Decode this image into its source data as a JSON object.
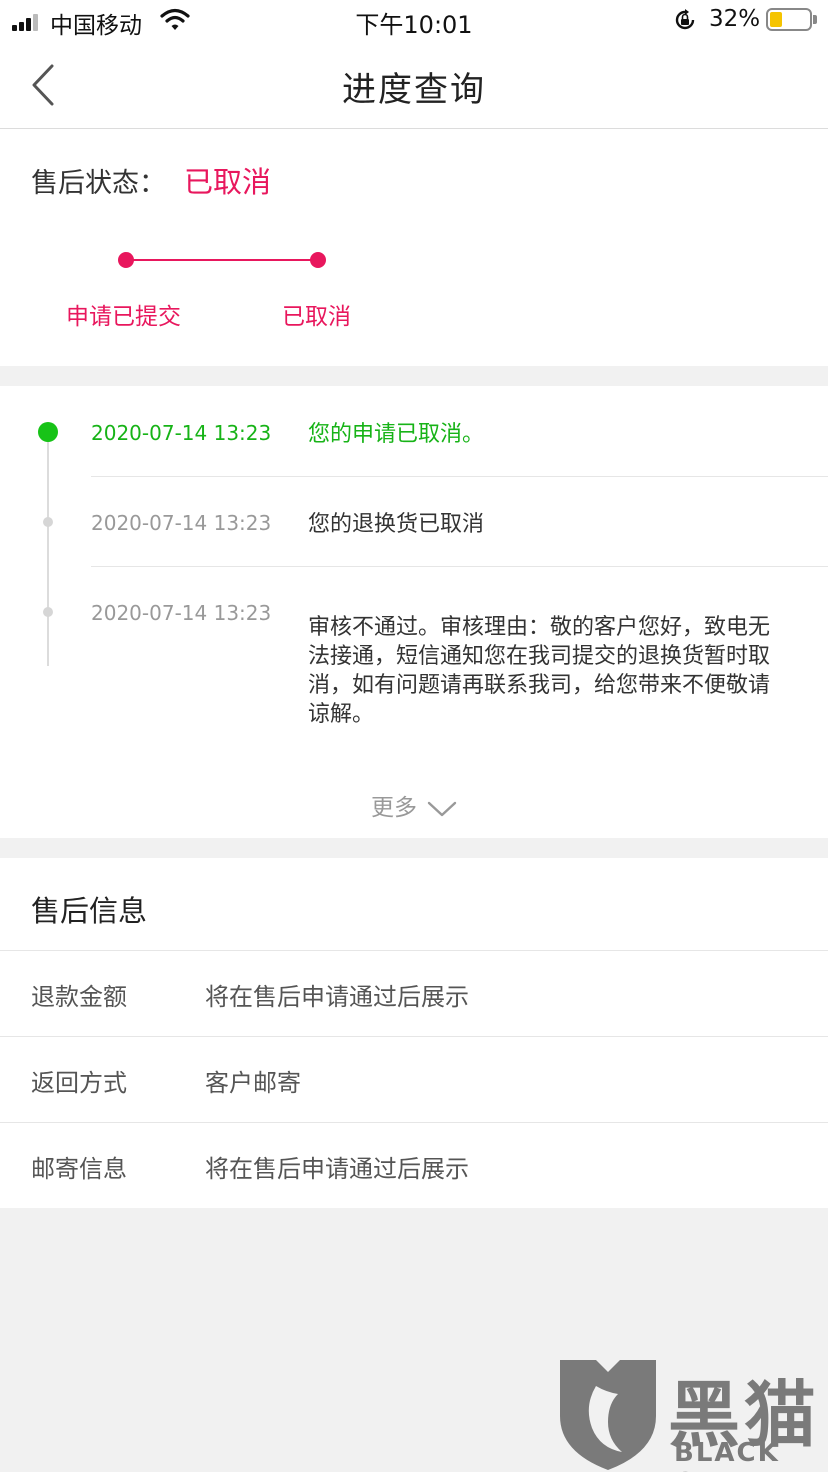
{
  "status_bar": {
    "carrier": "中国移动",
    "time": "下午10:01",
    "battery_percent": "32%",
    "battery_level": 0.32
  },
  "nav": {
    "title": "进度查询",
    "back_icon": "chevron-left-icon"
  },
  "status": {
    "label": "售后状态：",
    "value": "已取消",
    "steps": [
      "申请已提交",
      "已取消"
    ],
    "accent_color": "#e8175d"
  },
  "timeline": {
    "items": [
      {
        "time": "2020-07-14 13:23",
        "text": "您的申请已取消。"
      },
      {
        "time": "2020-07-14 13:23",
        "text": "您的退换货已取消"
      },
      {
        "time": "2020-07-14 13:23",
        "text": "审核不通过。审核理由：敬的客户您好，致电无法接通，短信通知您在我司提交的退换货暂时取消，如有问题请再联系我司，给您带来不便敬请谅解。"
      }
    ],
    "active_color": "#17b317",
    "more_label": "更多"
  },
  "info": {
    "title": "售后信息",
    "rows": [
      {
        "key": "退款金额",
        "value": "将在售后申请通过后展示"
      },
      {
        "key": "返回方式",
        "value": "客户邮寄"
      },
      {
        "key": "邮寄信息",
        "value": "将在售后申请通过后展示"
      }
    ]
  },
  "watermark": {
    "cn": "黑猫",
    "en": "BLACK CAT"
  }
}
